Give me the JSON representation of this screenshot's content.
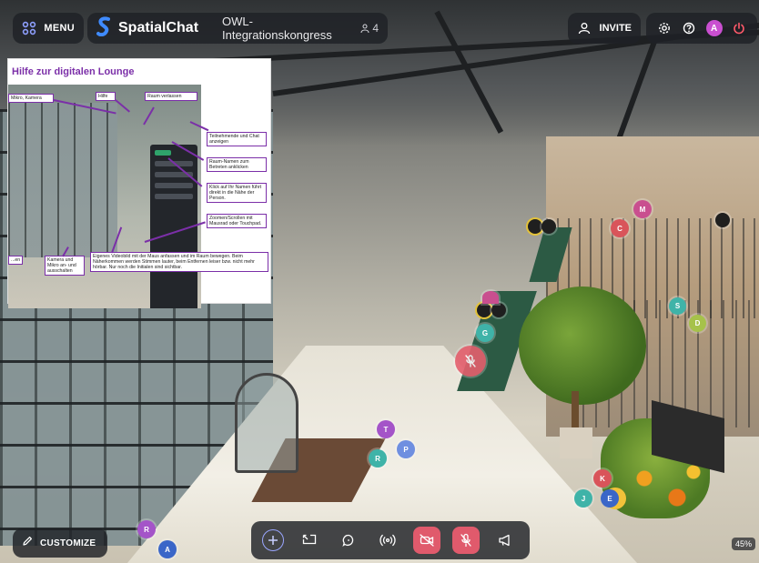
{
  "header": {
    "menu_label": "MENU",
    "brand_name": "SpatialChat",
    "room_name": "OWL-Integrationskongress",
    "participant_count": "4",
    "invite_label": "INVITE",
    "avatar_initial": "A"
  },
  "help_overlay": {
    "title": "Hilfe zur digitalen Lounge",
    "callouts": {
      "kamera": "Mikro, Kamera",
      "hilfe": "Hilfe",
      "raum_verlassen": "Raum verlassen",
      "teilnehmende": "Teilnehmende und Chat anzeigen",
      "raum_namen": "Raum-Namen zum Betreten anklicken",
      "klick_namen": "Klick auf Ihr Namen führt direkt in die Nähe der Person.",
      "zoomen": "Zoomen/Scrollen mit Mausrad oder Touchpad.",
      "links": "...en",
      "kamera_mikro": "Kamera und Mikro an- und ausschalten",
      "video": "Eigenes Videobild mit der Maus anfassen und im Raum bewegen. Beim Näherkommen werden Stimmen lauter, beim Entfernen leiser bzw. nicht mehr hörbar. Nur noch die Initialen sind sichtbar."
    }
  },
  "avatars": [
    {
      "initial": "M",
      "color": "#c94f8f"
    },
    {
      "initial": "C",
      "color": "#d9545a"
    },
    {
      "initial": "S",
      "color": "#3fb3a8"
    },
    {
      "initial": "D",
      "color": "#a6c24a"
    },
    {
      "initial": "G",
      "color": "#3fb3a8"
    },
    {
      "initial": "T",
      "color": "#a454c8"
    },
    {
      "initial": "P",
      "color": "#6f8fe0"
    },
    {
      "initial": "R",
      "color": "#3fb3a8"
    },
    {
      "initial": "K",
      "color": "#d9545a"
    },
    {
      "initial": "J",
      "color": "#3fb3a8"
    },
    {
      "initial": "E",
      "color": "#3a66c8"
    },
    {
      "initial": "R",
      "color": "#a454c8"
    },
    {
      "initial": "A",
      "color": "#3a66c8"
    }
  ],
  "footer": {
    "customize_label": "CUSTOMIZE",
    "zoom": "45%"
  },
  "colors": {
    "accent": "#7b2fa8",
    "danger": "#e05a6c",
    "pill_bg": "#1e2126"
  }
}
